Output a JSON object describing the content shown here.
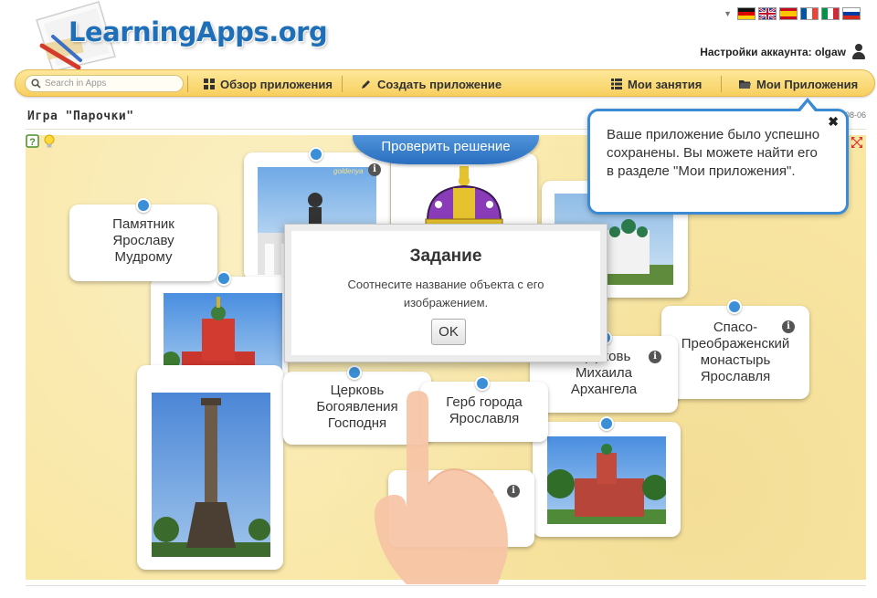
{
  "header": {
    "logo_text": "LearningApps.org",
    "account_label": "Настройки аккаунта: olgaw",
    "languages": [
      "de",
      "en",
      "es",
      "fr",
      "it",
      "ru"
    ]
  },
  "nav": {
    "search_placeholder": "Search in Apps",
    "items": [
      {
        "label": "Обзор приложения",
        "icon": "grid-icon"
      },
      {
        "label": "Создать приложение",
        "icon": "pencil-icon"
      },
      {
        "label": "Мои занятия",
        "icon": "list-icon"
      },
      {
        "label": "Мои Приложения",
        "icon": "folder-icon"
      }
    ]
  },
  "page": {
    "title": "Игра \"Парочки\"",
    "date_fragment": "08-06"
  },
  "board": {
    "check_button": "Проверить решение",
    "cards": [
      {
        "text": "Памятник Ярославу Мудрому"
      },
      {
        "text": "Спасо-Преображенский монастырь Ярославля"
      },
      {
        "text": "Церковь Михаила Архангела"
      },
      {
        "text": "Церковь Богоявления Господня"
      },
      {
        "text": "Герб города Ярославля"
      }
    ],
    "photo_caption": "goldenya"
  },
  "dialog": {
    "title": "Задание",
    "text": "Соотнесите название объекта с его изображением.",
    "ok_label": "OK"
  },
  "tooltip": {
    "text": "Ваше приложение было успешно сохранены. Вы можете найти его в разделе \"Мои приложения\".",
    "close": "✖"
  },
  "colors": {
    "accent_blue": "#3b8fd6",
    "navbar_yellow": "#f8cf5e",
    "board_bg": "#f9e7a4",
    "logo_blue": "#1e6fb8"
  }
}
